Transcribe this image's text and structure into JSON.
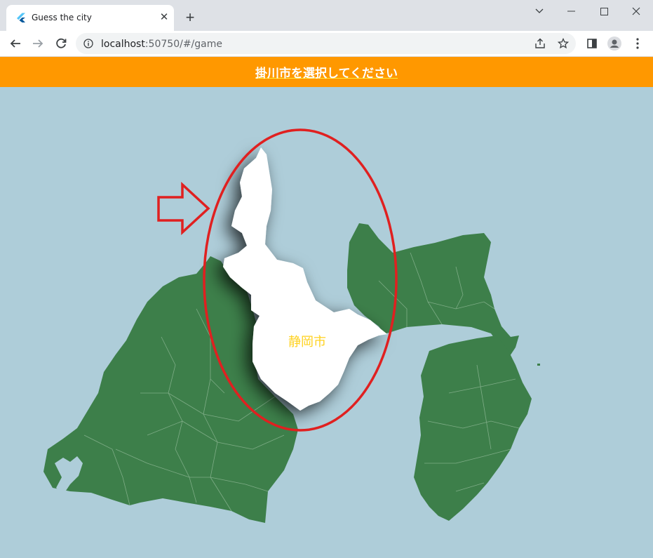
{
  "browser": {
    "tab_title": "Guess the city",
    "url_host": "localhost",
    "url_rest": ":50750/#/game",
    "tab_close_glyph": "✕",
    "new_tab_glyph": "+",
    "icons": [
      "flutter-icon",
      "back-arrow-icon",
      "forward-arrow-icon",
      "reload-icon",
      "info-icon",
      "share-icon",
      "star-icon",
      "sidepanel-icon",
      "profile-icon",
      "menu-dots-icon",
      "minimize-icon",
      "maximize-icon",
      "close-icon",
      "chevron-down-icon"
    ]
  },
  "app": {
    "header_title": "掛川市を選択してください",
    "colors": {
      "header": "#ff9800",
      "sea": "#aecdd9",
      "land": "#3d7f4a",
      "selected_city": "#ffffff",
      "city_label": "#ffd21f",
      "annotation": "#e02020"
    }
  },
  "map": {
    "selected_city_label": "静岡市"
  }
}
